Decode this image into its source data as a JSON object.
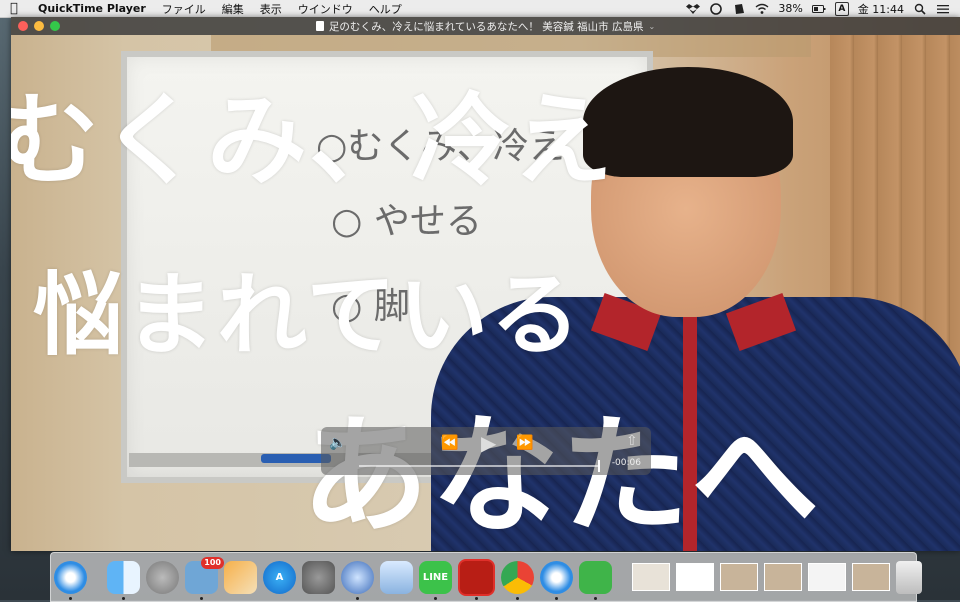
{
  "menubar": {
    "app_name": "QuickTime Player",
    "menus": [
      "ファイル",
      "編集",
      "表示",
      "ウインドウ",
      "ヘルプ"
    ],
    "battery": "38%",
    "input_source": "A",
    "clock": "金 11:44"
  },
  "window": {
    "title": "足のむくみ、冷えに悩まれているあなたへ！ 美容鍼 福山市 広島県"
  },
  "video": {
    "caption_line1": "むくみ、冷え",
    "caption_line2": "悩まれている",
    "caption_line3": "あなたへ",
    "board_line1": "○むくみ、冷え",
    "board_line2": "○ やせる",
    "board_line3": "○ 脚",
    "time_remaining": "-00:06"
  },
  "dock": {
    "items": [
      "safari-icon",
      "finder-icon",
      "launchpad-icon",
      "preview-icon",
      "pages-icon",
      "app-store-icon",
      "system-preferences-icon",
      "quicktime-icon",
      "preview-2-icon",
      "line-icon",
      "acrobat-icon",
      "chrome-icon",
      "safari-2-icon",
      "evernote-icon"
    ],
    "badge_count": "100",
    "line_label": "LINE"
  },
  "colors": {
    "accent_red": "#b3252b",
    "jacket": "#1a2a58",
    "caption": "#ffffff"
  }
}
